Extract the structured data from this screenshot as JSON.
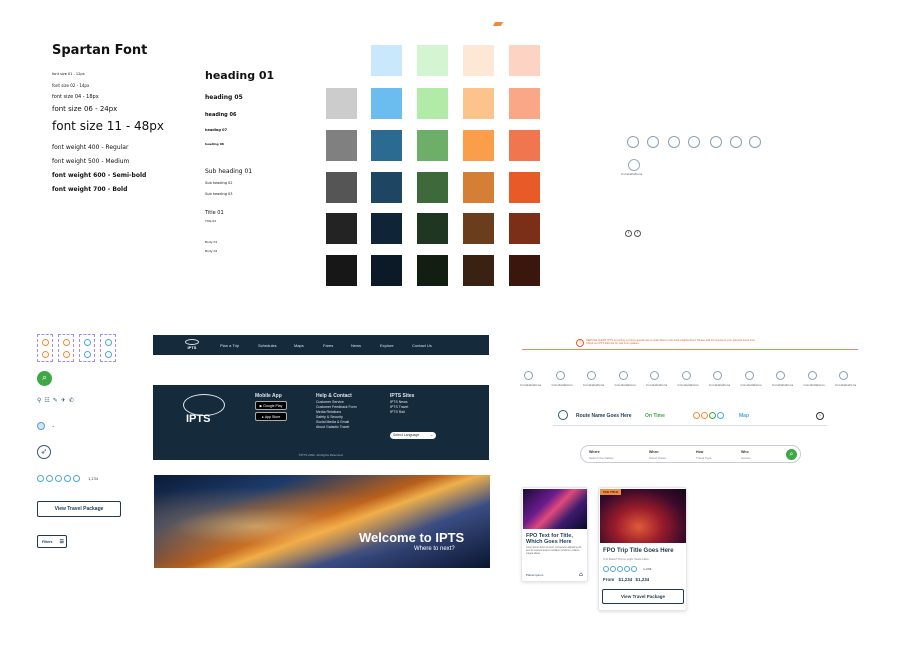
{
  "typography": {
    "title": "Spartan Font",
    "sizes": [
      "font size 01 - 12px",
      "font size 02 - 14px",
      "font size 04 - 18px",
      "font size 06 - 24px",
      "font size 11 - 48px"
    ],
    "weights": [
      "font weight 400 - Regular",
      "font weight 500 - Medium",
      "font weight 600 - Semi-bold",
      "font weight 700 - Bold"
    ]
  },
  "headings": {
    "h1": "heading 01",
    "h5": "heading 05",
    "h6": "heading 06",
    "h7": "heading 07",
    "h8": "heading 08",
    "sub1": "Sub heading 01",
    "sub2": "Sub heading 02",
    "sub3": "Sub heading 03",
    "title1": "Title 01",
    "title2": "Title 02",
    "body1": "Body 01",
    "body2": "Body 02"
  },
  "palette": {
    "rows": [
      [
        "",
        "",
        "#c9e8fc",
        "#d4f5d2",
        "#fde8d6",
        "#fdd3c3"
      ],
      [
        "#cccccc",
        "",
        "#6bbcef",
        "#b2eaa8",
        "#fcc38d",
        "#f9a787"
      ],
      [
        "#808080",
        "",
        "#2c6b91",
        "#6dae69",
        "#fb9e4c",
        "#ef764e"
      ],
      [
        "#555555",
        "",
        "#1e4562",
        "#3e6a3b",
        "#d57e35",
        "#e85a27"
      ],
      [
        "#232323",
        "",
        "#0f2537",
        "#1f3622",
        "#6a3e1d",
        "#7b2e18"
      ],
      [
        "#171717",
        "",
        "#0b1a26",
        "#121e12",
        "#3a2212",
        "#3a160c"
      ]
    ]
  },
  "icons": {
    "constellation_label": "Constellations"
  },
  "nav": {
    "logo": "IPTS",
    "items": [
      "Plan a Trip",
      "Schedules",
      "Maps",
      "Fares",
      "News",
      "Explore",
      "Contact Us"
    ]
  },
  "footer": {
    "logo": "IPTS",
    "mobile_title": "Mobile App",
    "google_play": "Google Play",
    "app_store": "App Store",
    "help_title": "Help & Contact",
    "help_links": [
      "Customer Service",
      "Customer Feedback Form",
      "Media Relations",
      "Safety & Security",
      "Social Media & Email",
      "About Galactic Travel"
    ],
    "sites_title": "IPTS Sites",
    "sites_links": [
      "IPTS News",
      "IPTS Travel",
      "IPTS Rail"
    ],
    "language": "Select Language",
    "copyright": "©IPTS 2022. All Rights Reserved."
  },
  "hero": {
    "title": "Welcome to IPTS",
    "subtitle": "Where to next?"
  },
  "left_components": {
    "rating_count": "1,234",
    "view_package": "View Travel Package",
    "filters": "Filters"
  },
  "alert": {
    "text": "SERVICE ALERT: IPTS is running on Nova speeds due to solar flares in the local neighborhood. Please add 10 minutes to your planned travel time.",
    "subtext": "Check our IPTS Rail site for real time updates."
  },
  "route": {
    "name": "Route Name Goes Here",
    "status": "On Time",
    "map": "Map"
  },
  "search": {
    "fields": [
      {
        "label": "Where",
        "placeholder": "Search the Galaxy"
      },
      {
        "label": "When",
        "placeholder": "Select Dates"
      },
      {
        "label": "How",
        "placeholder": "Travel Type"
      },
      {
        "label": "Who",
        "placeholder": "Guests"
      }
    ]
  },
  "card1": {
    "title": "FPO Text for Title, Which Goes Here",
    "body": "Lorem ipsum dolor sit amet, consectetur adipiscing elit, sed do eiusmod tempor incididunt ut labore et dolore magna aliqua.",
    "meta": "Planet ipsum"
  },
  "card2": {
    "tag": "TAG TITLE",
    "title": "FPO Trip Title Goes Here",
    "subtitle": "X-K Dwarf Trip to Light Years Here",
    "rating_count": "1,234",
    "price_prefix": "From",
    "price_old": "$1,234",
    "price_new": "$1,234",
    "button": "View Travel Package"
  }
}
